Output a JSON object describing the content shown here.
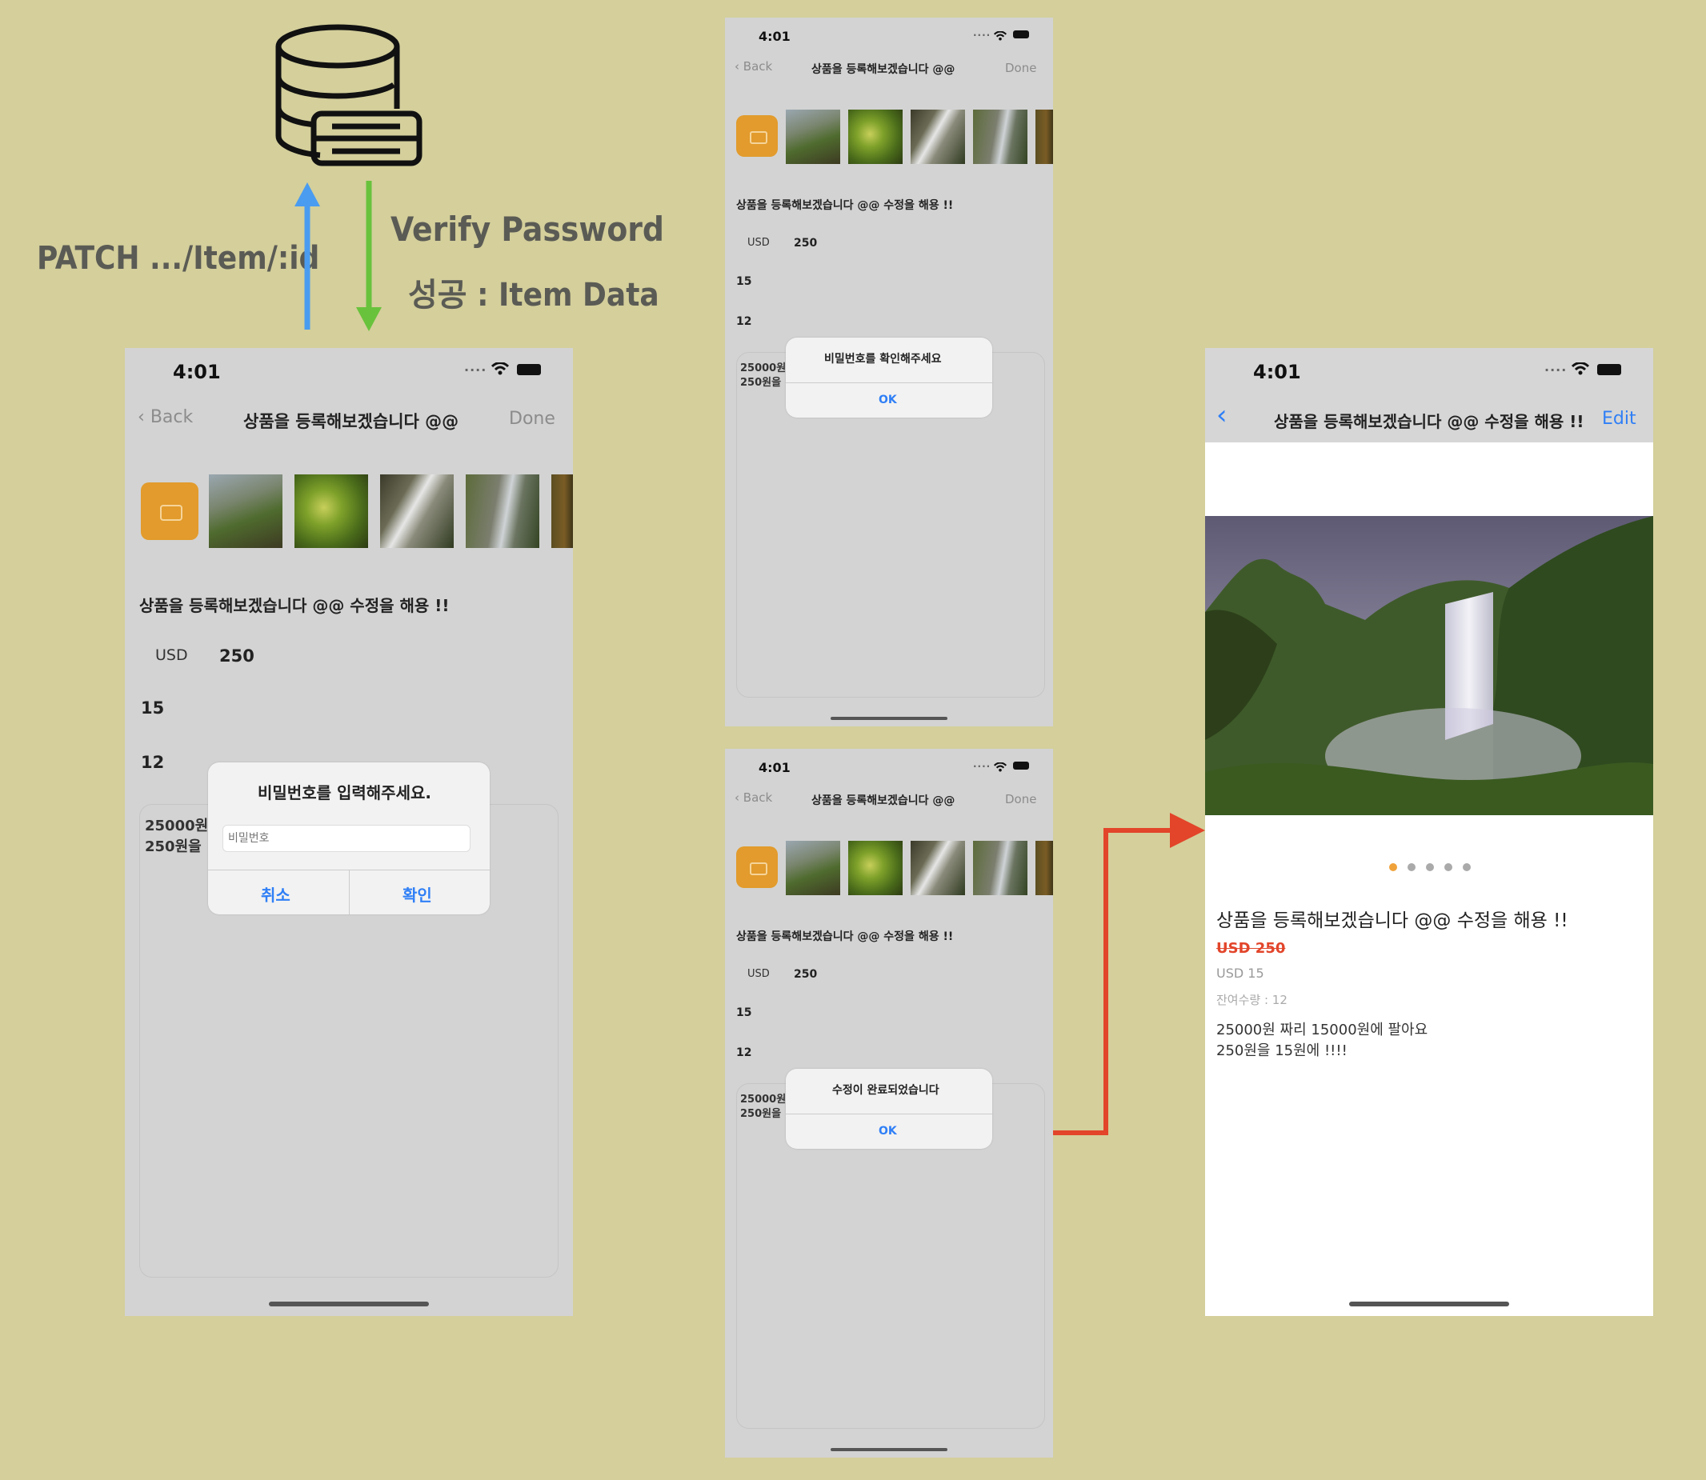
{
  "annotations": {
    "request": "PATCH  .../Item/:id",
    "response_line1": "Verify Password",
    "response_line2": "성공 : Item Data",
    "database_icon": "database-server-icon",
    "colors": {
      "request_arrow": "#4a9cf0",
      "response_arrow": "#69c23c",
      "flow_arrow": "#e2452a"
    }
  },
  "status_bar": {
    "time": "4:01",
    "signal": "....",
    "wifi_icon": "wifi-icon",
    "battery_icon": "battery-icon"
  },
  "edit_screen": {
    "back_label": "Back",
    "title": "상품을 등록해보겠습니다 @@",
    "done_label": "Done",
    "item_name": "상품을 등록해보겠습니다 @@ 수정을 해용 !!",
    "currency": "USD",
    "price": "250",
    "discount": "15",
    "stock": "12",
    "description_line1": "25000원",
    "description_line2": "250원을"
  },
  "password_alert": {
    "title": "비밀번호를 입력해주세요.",
    "placeholder": "비밀번호",
    "cancel_label": "취소",
    "confirm_label": "확인"
  },
  "verify_alert": {
    "message": "비밀번호를 확인해주세요",
    "ok_label": "OK"
  },
  "success_alert": {
    "message": "수정이 완료되었습니다",
    "ok_label": "OK"
  },
  "detail_screen": {
    "title": "상품을 등록해보겠습니다 @@ 수정을 해용 !!",
    "edit_label": "Edit",
    "item_name": "상품을 등록해보겠습니다 @@ 수정을 해용 !!",
    "original_price": "USD 250",
    "discounted_price": "USD 15",
    "stock_label": "잔여수량 : 12",
    "description_line1": "25000원 짜리 15000원에 팔아요",
    "description_line2": "250원을 15원에 !!!!",
    "page_count": 5,
    "current_page": 1
  }
}
